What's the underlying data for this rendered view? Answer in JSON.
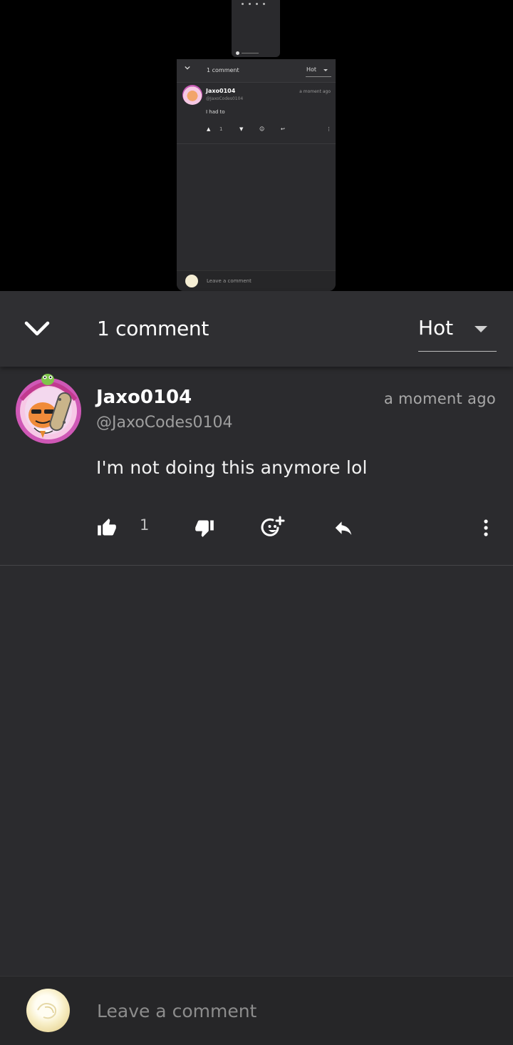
{
  "preview": {
    "comment_count": "1 comment",
    "sort_value": "Hot",
    "username": "Jaxo0104",
    "handle": "@JaxoCodes0104",
    "timestamp": "a moment ago",
    "comment_text": "I had to",
    "like_count": "1",
    "input_placeholder": "Leave a comment"
  },
  "header": {
    "comment_count": "1 comment",
    "sort_value": "Hot"
  },
  "comment": {
    "username": "Jaxo0104",
    "handle": "@JaxoCodes0104",
    "timestamp": "a moment ago",
    "text": "I'm not doing this anymore lol",
    "like_count": "1"
  },
  "footer": {
    "input_placeholder": "Leave a comment"
  },
  "icons": {
    "collapse": "chevron-down-icon",
    "sort": "caret-down-icon",
    "like": "thumbs-up-icon",
    "dislike": "thumbs-down-icon",
    "react": "add-emoji-icon",
    "reply": "reply-icon",
    "more": "more-vertical-icon"
  },
  "colors": {
    "background": "#2b2b2e",
    "header": "#2f2f32",
    "footer": "#262628",
    "text": "#ffffff",
    "muted": "#9e9e9e"
  }
}
